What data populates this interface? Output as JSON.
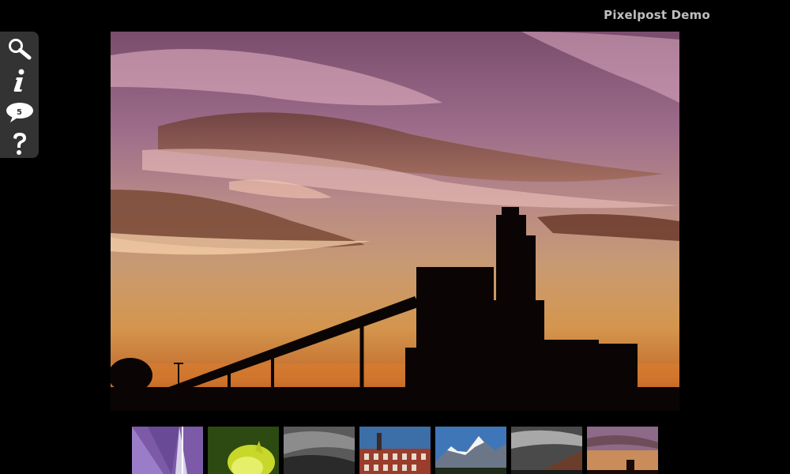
{
  "site": {
    "title": "Pixelpost Demo"
  },
  "toolbar": {
    "comment_count": "5",
    "buttons": [
      {
        "name": "search",
        "icon": "magnifier-icon"
      },
      {
        "name": "info",
        "icon": "info-icon"
      },
      {
        "name": "comments",
        "icon": "speech-bubble-icon"
      },
      {
        "name": "help",
        "icon": "question-mark-icon"
      }
    ]
  },
  "photo": {
    "subject": "industrial plant silhouette at sunset"
  },
  "thumbnails": [
    {
      "subject": "purple architecture"
    },
    {
      "subject": "yellow flower"
    },
    {
      "subject": "stormy sky"
    },
    {
      "subject": "brick building"
    },
    {
      "subject": "snowy mountains"
    },
    {
      "subject": "clouds over building"
    },
    {
      "subject": "industrial plant at sunset"
    }
  ],
  "colors": {
    "background": "#000000",
    "panel": "#333333",
    "title": "#bfbfbf"
  }
}
